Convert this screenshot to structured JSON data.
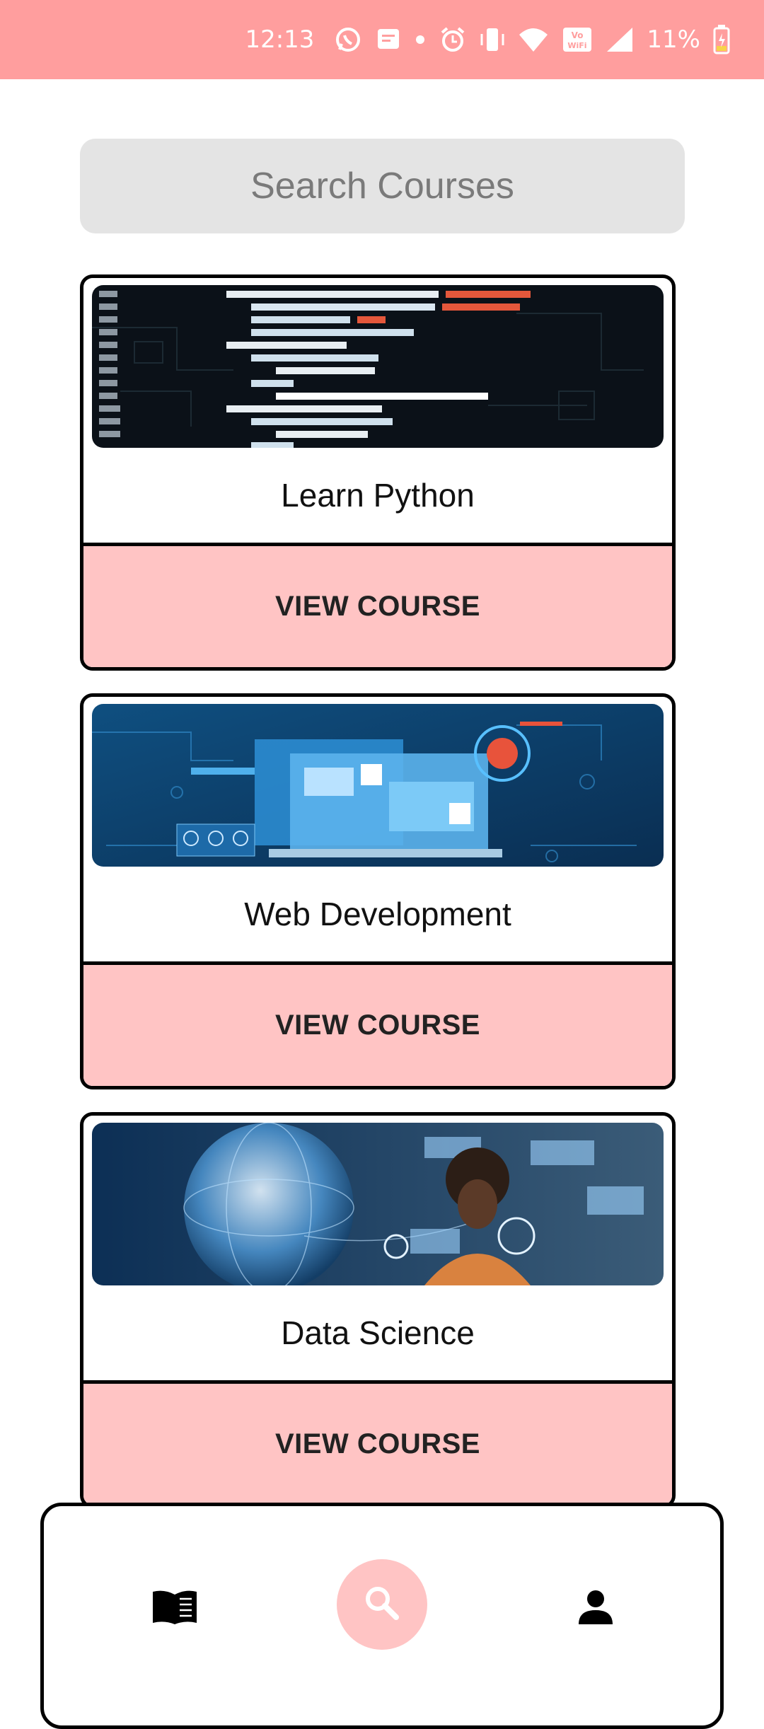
{
  "status_bar": {
    "time": "12:13",
    "battery": "11%",
    "icons": [
      "whatsapp-icon",
      "message-icon",
      "dot-icon",
      "alarm-icon",
      "vibrate-icon",
      "wifi-icon",
      "vowifi-icon",
      "signal-icon",
      "battery-charging-icon"
    ]
  },
  "search": {
    "placeholder": "Search Courses",
    "value": ""
  },
  "courses": [
    {
      "title": "Learn Python",
      "button_label": "VIEW COURSE",
      "image": "python-code-image"
    },
    {
      "title": "Web Development",
      "button_label": "VIEW COURSE",
      "image": "web-dashboard-image"
    },
    {
      "title": "Data Science",
      "button_label": "VIEW COURSE",
      "image": "globe-data-image"
    }
  ],
  "bottom_nav": {
    "items": [
      "book-icon",
      "search-icon",
      "person-icon"
    ],
    "active": "search-icon"
  },
  "colors": {
    "status_bar": "#ff9e9e",
    "button_bg": "#ffc4c4",
    "search_bg": "#e4e4e4"
  }
}
